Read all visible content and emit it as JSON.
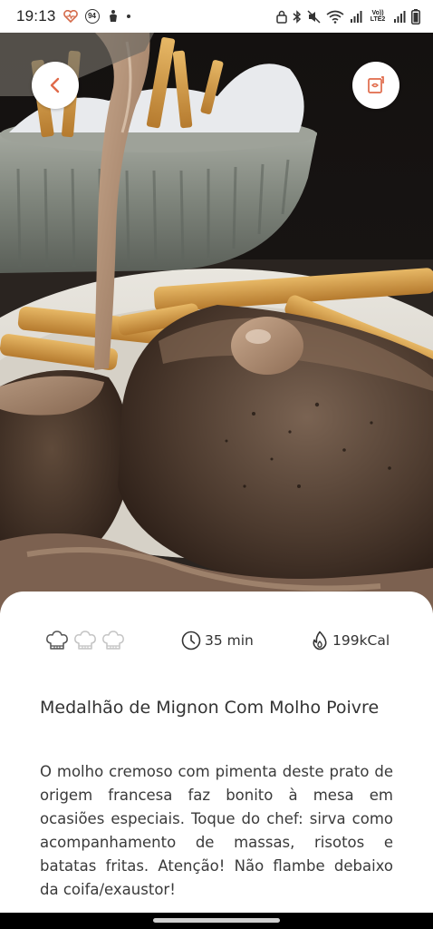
{
  "status_bar": {
    "time": "19:13",
    "notification_badge": "94",
    "network_label": "Vo)) LTE2"
  },
  "header": {
    "back_icon": "chevron-left-icon",
    "favorite_icon": "recipe-card-icon",
    "accent_color": "#e06a4a"
  },
  "recipe": {
    "difficulty": {
      "level": 1,
      "max": 3,
      "icon": "chef-hat-icon"
    },
    "time": "35 min",
    "calories": "199kCal",
    "title": "Medalhão de Mignon Com Molho Poivre",
    "description": "O molho cremoso com pimenta deste prato de origem francesa faz bonito à mesa em ocasiões especiais. Toque do chef: sirva como acompanhamento de massas, risotos e batatas fritas. Atenção! Não flambe debaixo da coifa/exaustor!"
  }
}
